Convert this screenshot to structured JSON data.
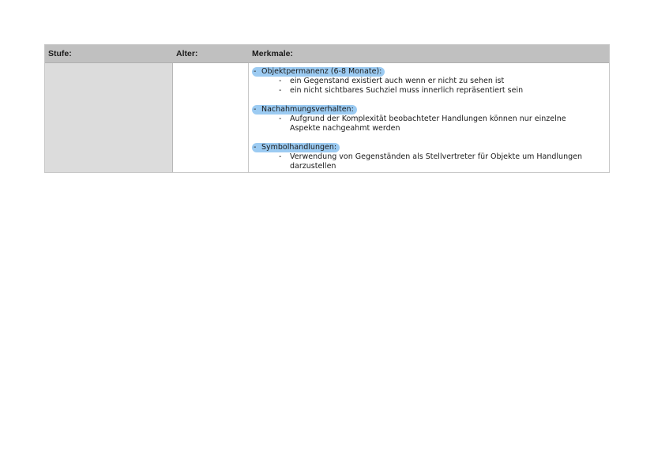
{
  "table": {
    "headers": {
      "stufe": "Stufe:",
      "alter": "Alter:",
      "merkmale": "Merkmale:"
    },
    "bullet": "-",
    "sections": [
      {
        "title": "Objektpermanenz (6-8 Monate):",
        "items": [
          "ein Gegenstand existiert auch wenn er nicht zu sehen ist",
          "ein nicht sichtbares Suchziel muss innerlich repräsentiert sein"
        ]
      },
      {
        "title": "Nachahmungsverhalten:",
        "items": [
          "Aufgrund der Komplexität beobachteter Handlungen können nur einzelne Aspekte nachgeahmt werden"
        ]
      },
      {
        "title": "Symbolhandlungen:",
        "items": [
          "Verwendung von Gegenständen als Stellvertreter für Objekte um Handlungen darzustellen"
        ]
      }
    ],
    "highlight_color": "#9ccbf2"
  }
}
